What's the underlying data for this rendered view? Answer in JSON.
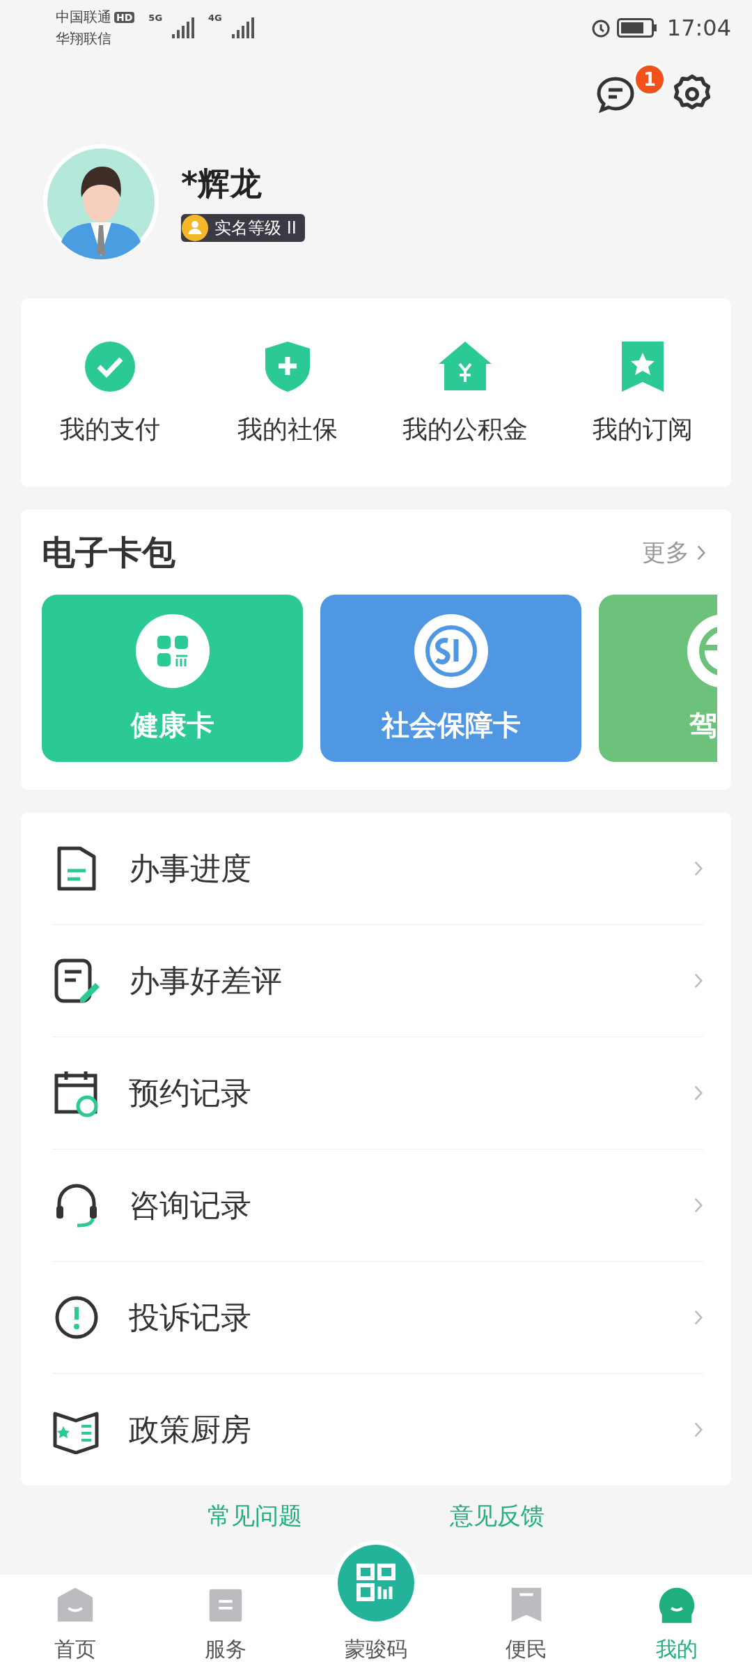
{
  "status_bar": {
    "carrier_1": "中国联通",
    "hd": "HD",
    "carrier_2": "华翔联信",
    "network_1": "5G",
    "network_2": "4G",
    "time": "17:04"
  },
  "header": {
    "message_badge": "1"
  },
  "profile": {
    "name": "*辉龙",
    "level_badge": "实名等级 II"
  },
  "quick_actions": [
    {
      "label": "我的支付"
    },
    {
      "label": "我的社保"
    },
    {
      "label": "我的公积金"
    },
    {
      "label": "我的订阅"
    }
  ],
  "card_wallet": {
    "title": "电子卡包",
    "more": "更多",
    "cards": [
      {
        "label": "健康卡",
        "color": "#2bc996"
      },
      {
        "label": "社会保障卡",
        "color": "#4f97e3"
      },
      {
        "label": "驾",
        "color": "#6cc27a"
      }
    ]
  },
  "menu": [
    {
      "label": "办事进度"
    },
    {
      "label": "办事好差评"
    },
    {
      "label": "预约记录"
    },
    {
      "label": "咨询记录"
    },
    {
      "label": "投诉记录"
    },
    {
      "label": "政策厨房"
    }
  ],
  "footer_links": [
    "常见问题",
    "意见反馈"
  ],
  "tab_bar": [
    {
      "label": "首页",
      "selected": false
    },
    {
      "label": "服务",
      "selected": false
    },
    {
      "label": "蒙骏码",
      "selected": false
    },
    {
      "label": "便民",
      "selected": false
    },
    {
      "label": "我的",
      "selected": true
    }
  ]
}
